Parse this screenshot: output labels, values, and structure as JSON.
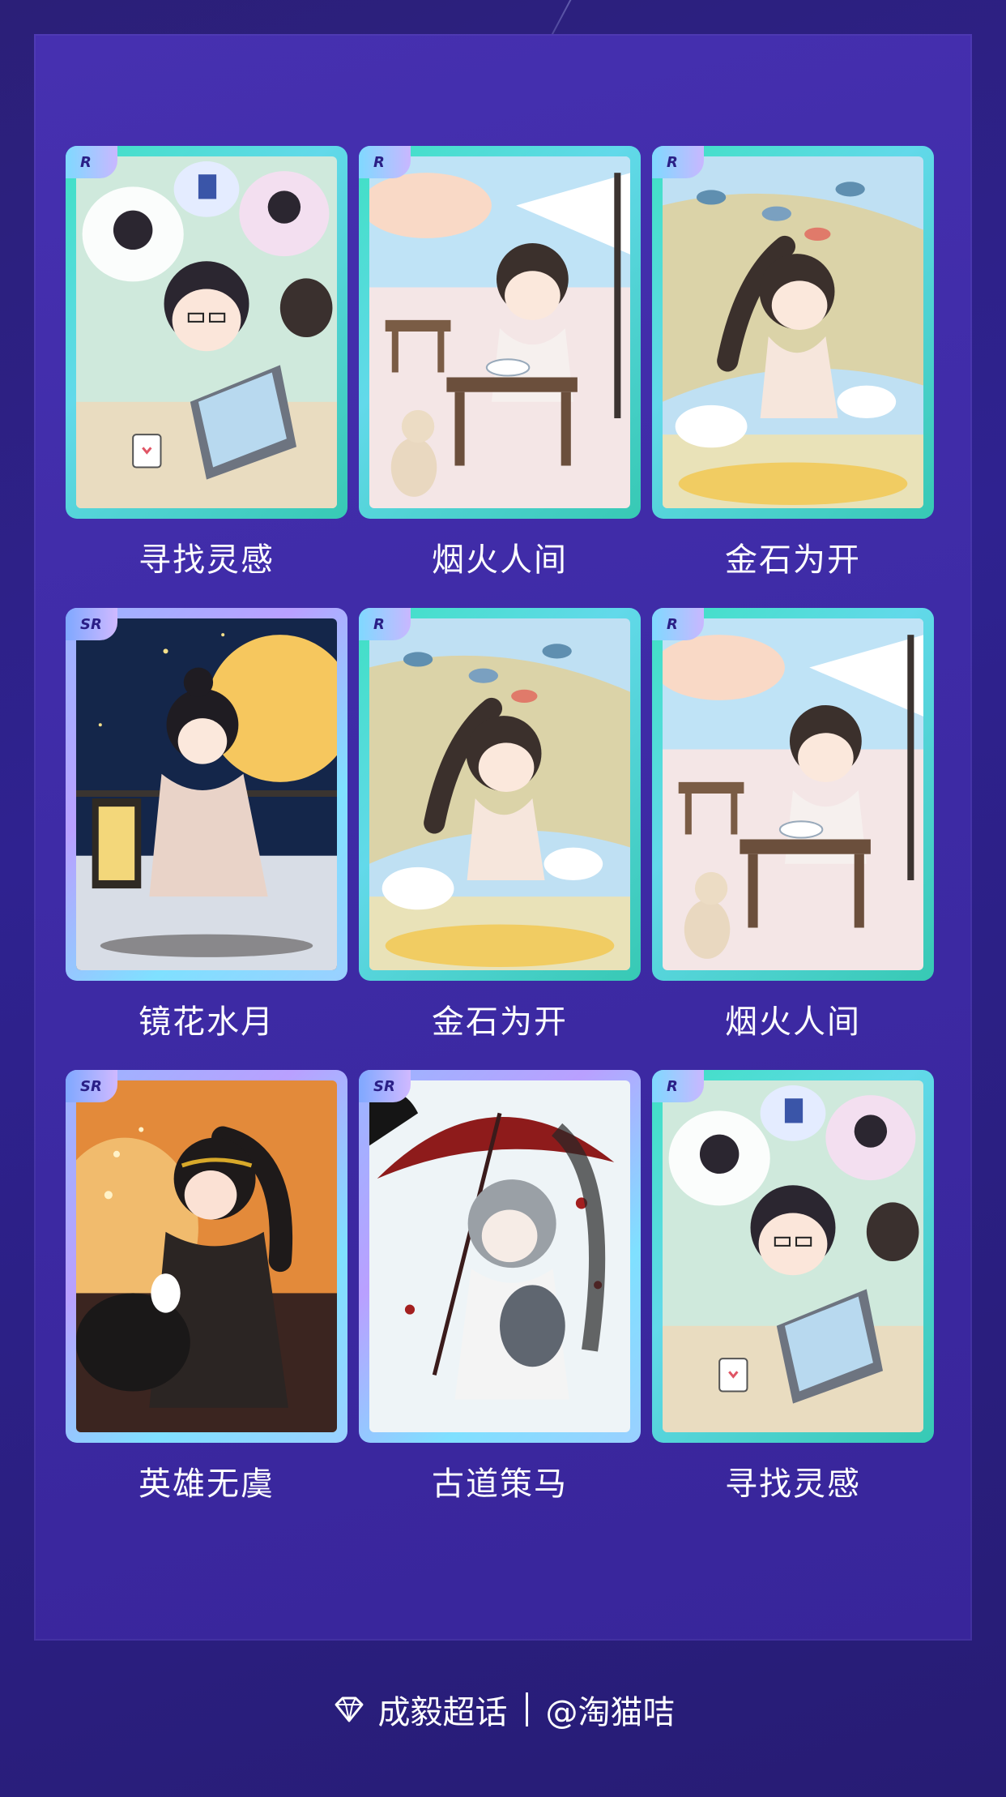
{
  "cards": [
    {
      "rarity": "R",
      "title": "寻找灵感",
      "scene": "laptop-dreamer"
    },
    {
      "rarity": "R",
      "title": "烟火人间",
      "scene": "dining-table"
    },
    {
      "rarity": "R",
      "title": "金石为开",
      "scene": "fish-ponytail"
    },
    {
      "rarity": "SR",
      "title": "镜花水月",
      "scene": "moon-lantern"
    },
    {
      "rarity": "R",
      "title": "金石为开",
      "scene": "fish-ponytail"
    },
    {
      "rarity": "R",
      "title": "烟火人间",
      "scene": "dining-table"
    },
    {
      "rarity": "SR",
      "title": "英雄无虞",
      "scene": "fire-warrior"
    },
    {
      "rarity": "SR",
      "title": "古道策马",
      "scene": "red-umbrella"
    },
    {
      "rarity": "R",
      "title": "寻找灵感",
      "scene": "laptop-dreamer"
    }
  ],
  "footer": {
    "topic": "成毅超话",
    "handle": "@淘猫咭",
    "icon": "diamond-icon"
  },
  "colors": {
    "background": "#2b1f78",
    "panel": "#4630b0",
    "r_frame": "#3fe0c3",
    "sr_frame": "#9ab6ff"
  }
}
